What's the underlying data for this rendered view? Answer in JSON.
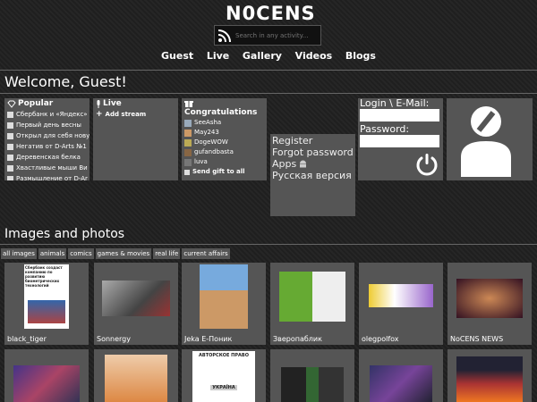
{
  "site": {
    "logo": "N0CENS"
  },
  "search": {
    "placeholder": "Search in any activity..."
  },
  "nav": [
    "Guest",
    "Live",
    "Gallery",
    "Videos",
    "Blogs"
  ],
  "welcome": "Welcome, Guest!",
  "popular": {
    "title": "Popular",
    "items": [
      "Сбербанк и «Яндекс»",
      "Первый день весны",
      "Открыл для себя нову",
      "Негатив от D-Arts №1",
      "Деревенская белка",
      "Хвастливые мыши Ви",
      "Размышление от D-Ar"
    ]
  },
  "live": {
    "title": "Live",
    "add_stream": "Add stream"
  },
  "congrats": {
    "title": "Congratulations",
    "users": [
      "SeeAsha",
      "May243",
      "DogeWOW",
      "gufandbasta",
      "luva"
    ],
    "send_gift": "Send gift to all"
  },
  "links": {
    "register": "Register",
    "forgot": "Forgot password",
    "apps": "Apps",
    "russian": "Русская версия"
  },
  "login": {
    "email_label": "Login \\ E-Mail:",
    "password_label": "Password:"
  },
  "images_title": "Images and photos",
  "tags": [
    "all images",
    "animals",
    "comics",
    "games & movies",
    "real life",
    "current affairs"
  ],
  "tiles": [
    "black_tiger",
    "Sonnergy",
    "Jeka E-Поник",
    "Зверопаблик",
    "olegpolfox",
    "NoCENS NEWS",
    "",
    "",
    "",
    "",
    "",
    ""
  ],
  "thumb_texts": [
    "Сбербанк создаст компанию по развитию биометрических технологий",
    "АВТОРСКОЕ ПРАВО",
    "УКРАЇНА"
  ],
  "colors": {
    "accent": "#ffffff",
    "panel": "#555555",
    "background": "#222222"
  }
}
